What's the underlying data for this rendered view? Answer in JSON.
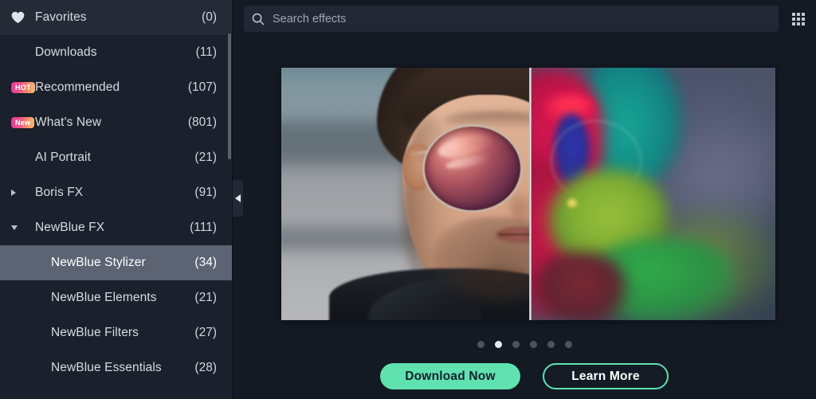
{
  "sidebar": {
    "items": [
      {
        "label": "Favorites",
        "count": "(0)",
        "lead": "heart-icon",
        "indent": false,
        "state": "header",
        "selected": false
      },
      {
        "label": "Downloads",
        "count": "(11)",
        "lead": "none",
        "indent": false,
        "state": "normal",
        "selected": false
      },
      {
        "label": "Recommended",
        "count": "(107)",
        "lead": "badge-hot",
        "indent": false,
        "state": "normal",
        "selected": false,
        "badge": "HOT"
      },
      {
        "label": "What's New",
        "count": "(801)",
        "lead": "badge-new",
        "indent": false,
        "state": "normal",
        "selected": false,
        "badge": "New"
      },
      {
        "label": "AI Portrait",
        "count": "(21)",
        "lead": "none",
        "indent": false,
        "state": "normal",
        "selected": false
      },
      {
        "label": "Boris FX",
        "count": "(91)",
        "lead": "caret-closed",
        "indent": false,
        "state": "normal",
        "selected": false
      },
      {
        "label": "NewBlue FX",
        "count": "(111)",
        "lead": "caret-open",
        "indent": false,
        "state": "normal",
        "selected": false
      },
      {
        "label": "NewBlue Stylizer",
        "count": "(34)",
        "lead": "none",
        "indent": true,
        "state": "normal",
        "selected": true
      },
      {
        "label": "NewBlue Elements",
        "count": "(21)",
        "lead": "none",
        "indent": true,
        "state": "normal",
        "selected": false
      },
      {
        "label": "NewBlue Filters",
        "count": "(27)",
        "lead": "none",
        "indent": true,
        "state": "normal",
        "selected": false
      },
      {
        "label": "NewBlue Essentials",
        "count": "(28)",
        "lead": "none",
        "indent": true,
        "state": "normal",
        "selected": false
      }
    ],
    "scrollbar_visible": true,
    "colors": {
      "background": "#1b212c",
      "header_row": "#242b36",
      "selected_row": "#5c6373",
      "text": "#d7dbe2",
      "badge_gradient_start": "#e0389c",
      "badge_gradient_end": "#f8c07c"
    }
  },
  "toolbar": {
    "search_placeholder": "Search effects",
    "search_value": "",
    "search_icon": "search-icon",
    "grid_icon": "grid-view-icon"
  },
  "collapse_handle": {
    "icon": "chevron-left-icon",
    "tooltip": "Collapse panel"
  },
  "preview": {
    "image_alt": "Before and after split comparison of a portrait with a stylizer effect applied",
    "split_position_percent": 50,
    "left_caption": "",
    "right_caption": ""
  },
  "carousel": {
    "total": 6,
    "active_index": 1,
    "dot_color": "#4c5360",
    "active_dot_color": "#e9edf2"
  },
  "cta": {
    "primary_label": "Download Now",
    "secondary_label": "Learn More",
    "accent_color": "#5fe2b0"
  }
}
